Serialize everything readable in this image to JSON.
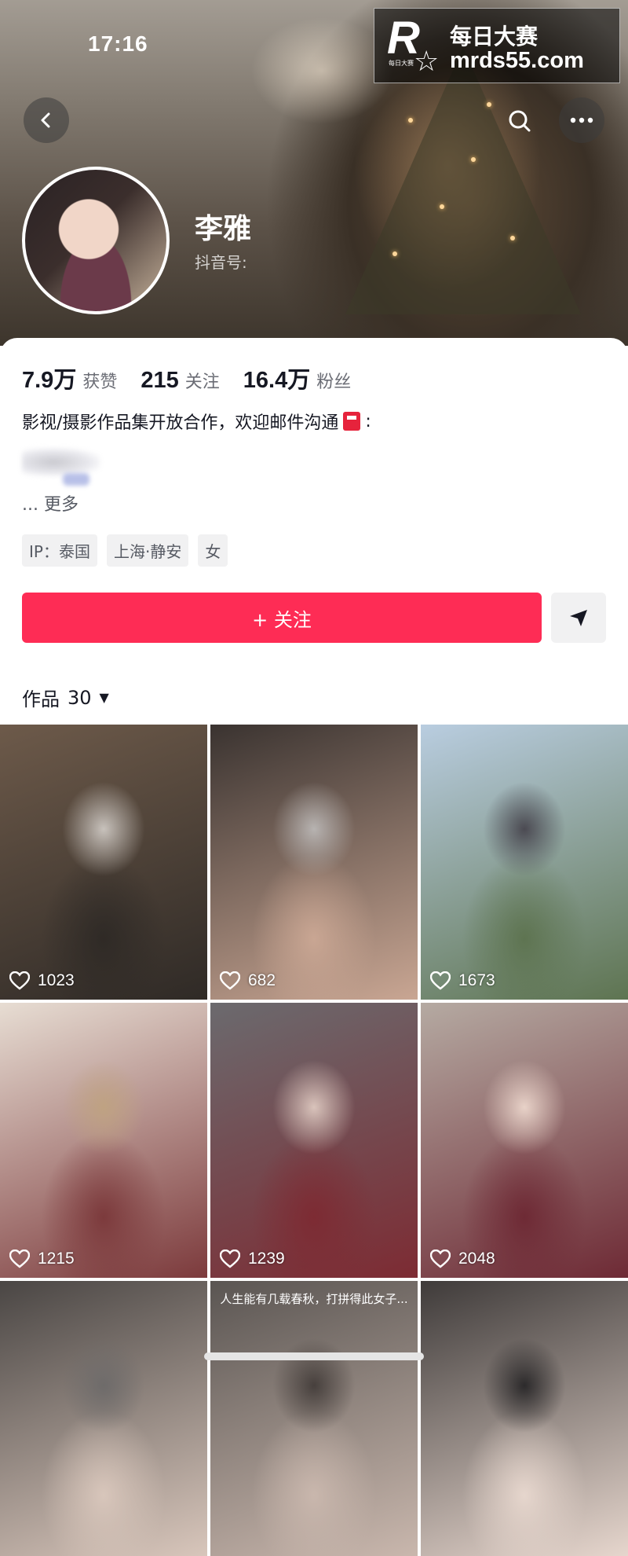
{
  "status_bar": {
    "time": "17:16"
  },
  "watermark": {
    "logo": "R",
    "logo_sub": "每日大赛",
    "title": "每日大赛",
    "url": "mrds55.com"
  },
  "profile": {
    "name": "李雅",
    "douyin_id_label": "抖音号:",
    "stats": [
      {
        "value": "7.9万",
        "label": "获赞"
      },
      {
        "value": "215",
        "label": "关注"
      },
      {
        "value": "16.4万",
        "label": "粉丝"
      }
    ],
    "bio": "影视/摄影作品集开放合作，欢迎邮件沟通",
    "bio_suffix": ":",
    "more": "... 更多",
    "tags": [
      "IP：泰国",
      "上海·静安",
      "女"
    ],
    "follow_label": "+ 关注"
  },
  "works": {
    "label": "作品",
    "count": "30",
    "items": [
      {
        "likes": "1023",
        "colors": [
          "#6d5a4a",
          "#2f2a26",
          "#c8c2bc"
        ],
        "caption": ""
      },
      {
        "likes": "682",
        "colors": [
          "#3a3330",
          "#c9a693",
          "#b7b3b1"
        ],
        "caption": ""
      },
      {
        "likes": "1673",
        "colors": [
          "#b9cde0",
          "#5e7451",
          "#4b4a52"
        ],
        "caption": ""
      },
      {
        "likes": "1215",
        "colors": [
          "#e7ddd3",
          "#7c3a3c",
          "#bfa282"
        ],
        "caption": ""
      },
      {
        "likes": "1239",
        "colors": [
          "#6b6a6e",
          "#7d2b33",
          "#d9c3bb"
        ],
        "caption": ""
      },
      {
        "likes": "2048",
        "colors": [
          "#b5aaa2",
          "#6e2a35",
          "#e8d2c8"
        ],
        "caption": ""
      },
      {
        "likes": "",
        "colors": [
          "#4a4644",
          "#d8c6bb",
          "#6e6b6a"
        ],
        "caption": ""
      },
      {
        "likes": "",
        "colors": [
          "#5a5552",
          "#c9b7ad",
          "#47403d"
        ],
        "caption": "人生能有几载春秋，打拼得此女子..."
      },
      {
        "likes": "",
        "colors": [
          "#3f3b3a",
          "#e6d6cd",
          "#2c2a2b"
        ],
        "caption": ""
      }
    ]
  }
}
